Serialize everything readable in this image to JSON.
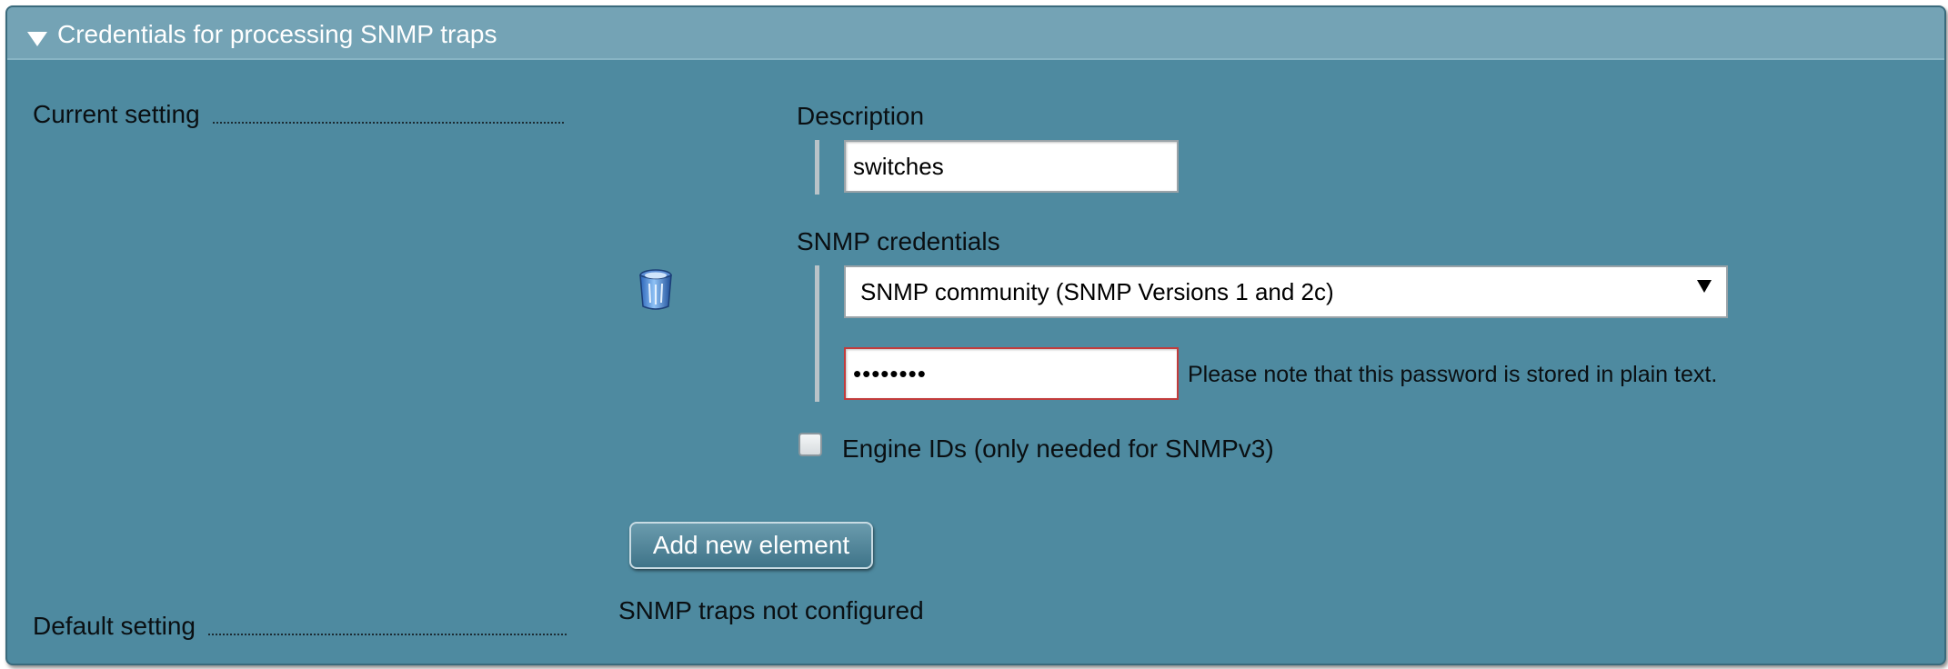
{
  "panel": {
    "title": "Credentials for processing SNMP traps"
  },
  "current_setting": {
    "label": "Current setting"
  },
  "default_setting": {
    "label": "Default setting",
    "value": "SNMP traps not configured"
  },
  "element": {
    "description_label": "Description",
    "description_value": "switches",
    "credentials_label": "SNMP credentials",
    "credentials_type_selected": "SNMP community (SNMP Versions 1 and 2c)",
    "password_mask": "••••••••",
    "password_note": "Please note that this password is stored in plain text.",
    "engine_ids_label": "Engine IDs (only needed for SNMPv3)"
  },
  "actions": {
    "add_new_element": "Add new element"
  },
  "icons": {
    "header_toggle": "triangle-down-icon",
    "delete": "trash-icon"
  },
  "colors": {
    "panel_bg": "#4e8aa0",
    "header_bg": "#74a3b5",
    "password_border": "#c23c3c"
  }
}
